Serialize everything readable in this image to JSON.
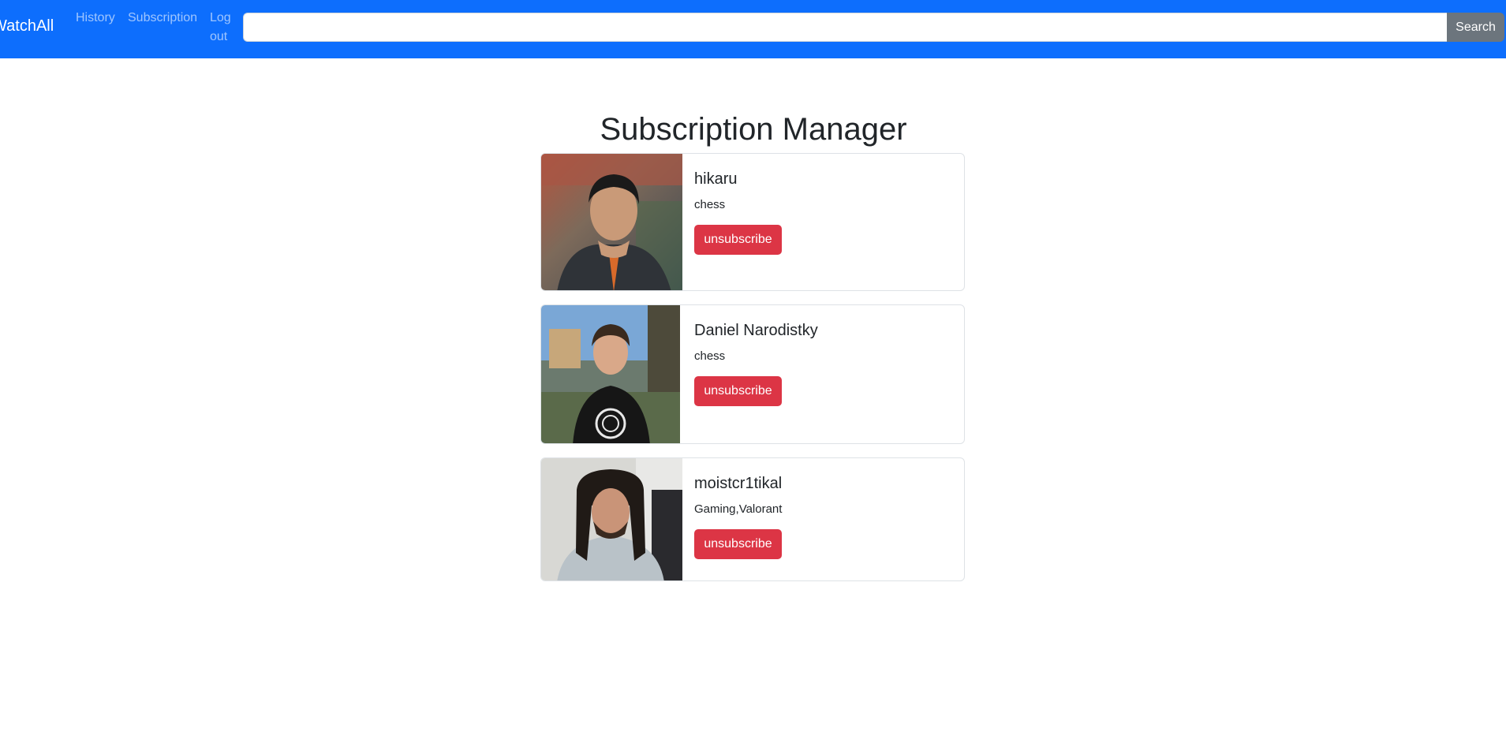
{
  "navbar": {
    "brand": "WatchAll",
    "links": [
      "History",
      "Subscription",
      "Log out"
    ],
    "search": {
      "value": "",
      "placeholder": "",
      "button_label": "Search"
    },
    "colors": {
      "background": "#0d6efd",
      "search_button": "#6c757d"
    }
  },
  "main": {
    "title": "Subscription Manager",
    "subscriptions": [
      {
        "name": "hikaru",
        "tags": "chess",
        "action_label": "unsubscribe",
        "avatar": "hikaru-photo"
      },
      {
        "name": "Daniel Narodistky",
        "tags": "chess",
        "action_label": "unsubscribe",
        "avatar": "daniel-narodistky-photo"
      },
      {
        "name": "moistcr1tikal",
        "tags": "Gaming,Valorant",
        "action_label": "unsubscribe",
        "avatar": "moistcr1tikal-photo"
      }
    ],
    "colors": {
      "unsubscribe_button": "#dc3545"
    }
  }
}
